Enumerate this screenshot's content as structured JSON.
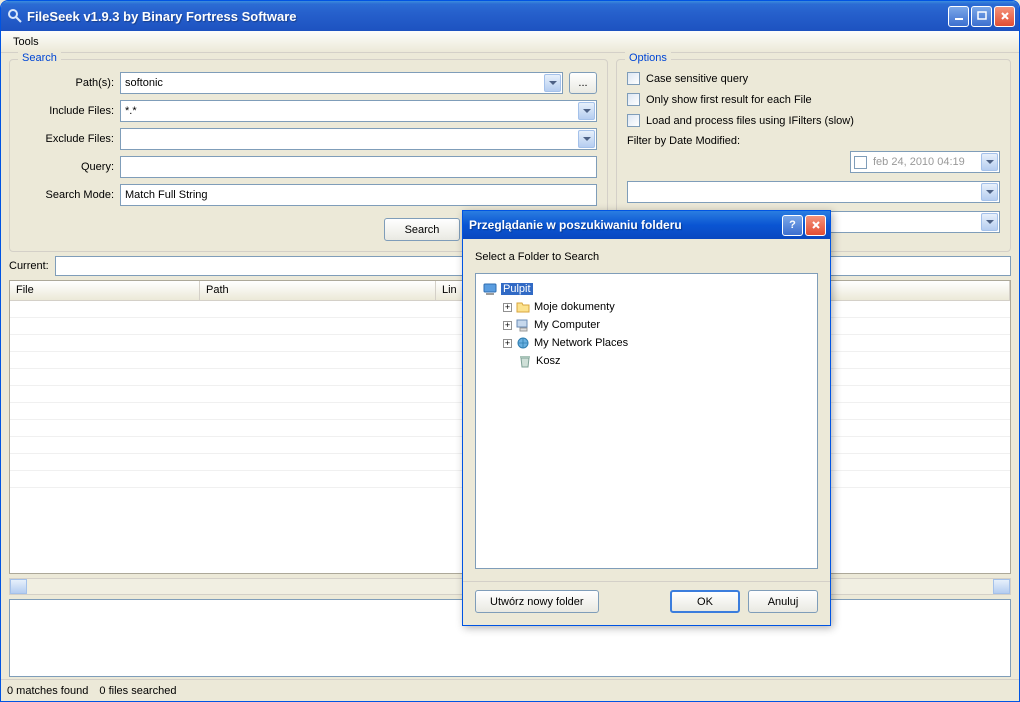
{
  "window": {
    "title": "FileSeek v1.9.3 by Binary Fortress Software"
  },
  "menubar": {
    "tools": "Tools"
  },
  "search": {
    "legend": "Search",
    "labels": {
      "paths": "Path(s):",
      "include": "Include Files:",
      "exclude": "Exclude Files:",
      "query": "Query:",
      "mode": "Search Mode:"
    },
    "values": {
      "paths": "softonic",
      "include": "*.*",
      "exclude": "",
      "query": "",
      "mode": "Match Full String"
    },
    "browse": "...",
    "button": "Search"
  },
  "options": {
    "legend": "Options",
    "case_sensitive": "Case sensitive query",
    "first_result": "Only show first result for each File",
    "ifilters": "Load and process files using IFilters (slow)",
    "filter_date_label": "Filter by Date Modified:",
    "date_value": "feb  24, 2010 04:19"
  },
  "current_label": "Current:",
  "table": {
    "file": "File",
    "path": "Path",
    "line": "Lin"
  },
  "status": {
    "matches": "0 matches found",
    "files": "0 files searched"
  },
  "dialog": {
    "title": "Przeglądanie w poszukiwaniu folderu",
    "instruction": "Select a Folder to Search",
    "tree": {
      "root": "Pulpit",
      "docs": "Moje dokumenty",
      "computer": "My Computer",
      "network": "My Network Places",
      "trash": "Kosz"
    },
    "buttons": {
      "new_folder": "Utwórz nowy folder",
      "ok": "OK",
      "cancel": "Anuluj"
    }
  }
}
